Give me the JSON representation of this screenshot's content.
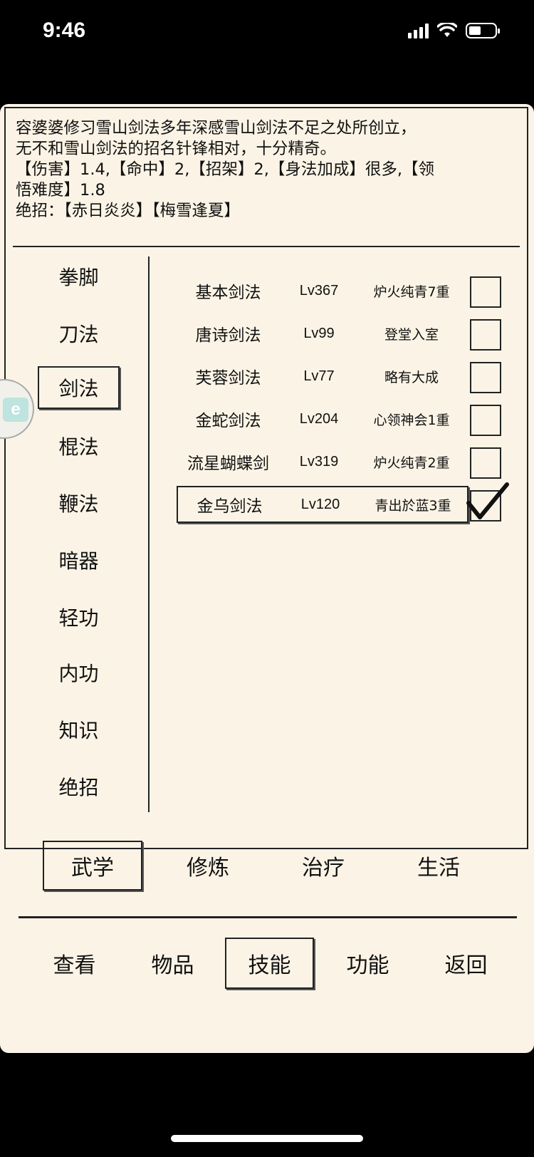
{
  "status": {
    "time": "9:46"
  },
  "description": {
    "lines": [
      "容婆婆修习雪山剑法多年深感雪山剑法不足之处所创立，",
      "无不和雪山剑法的招名针锋相对，十分精奇。",
      "【伤害】1.4,【命中】2,【招架】2,【身法加成】很多,【领",
      "悟难度】1.8",
      "绝招：【赤日炎炎】【梅雪逢夏】"
    ]
  },
  "categories": [
    "拳脚",
    "刀法",
    "剑法",
    "棍法",
    "鞭法",
    "暗器",
    "轻功",
    "内功",
    "知识",
    "绝招"
  ],
  "active_category": "剑法",
  "skills": [
    {
      "name": "基本剑法",
      "level": "Lv367",
      "rank": "炉火纯青7重",
      "checked": false
    },
    {
      "name": "唐诗剑法",
      "level": "Lv99",
      "rank": "登堂入室",
      "checked": false
    },
    {
      "name": "芙蓉剑法",
      "level": "Lv77",
      "rank": "略有大成",
      "checked": false
    },
    {
      "name": "金蛇剑法",
      "level": "Lv204",
      "rank": "心领神会1重",
      "checked": false
    },
    {
      "name": "流星蝴蝶剑",
      "level": "Lv319",
      "rank": "炉火纯青2重",
      "checked": false
    },
    {
      "name": "金乌剑法",
      "level": "Lv120",
      "rank": "青出於蓝3重",
      "checked": true
    }
  ],
  "tabs": [
    "武学",
    "修炼",
    "治疗",
    "生活"
  ],
  "active_tab": "武学",
  "nav": [
    "查看",
    "物品",
    "技能",
    "功能",
    "返回"
  ],
  "active_nav": "技能",
  "side_badge": {
    "letter": "e"
  }
}
